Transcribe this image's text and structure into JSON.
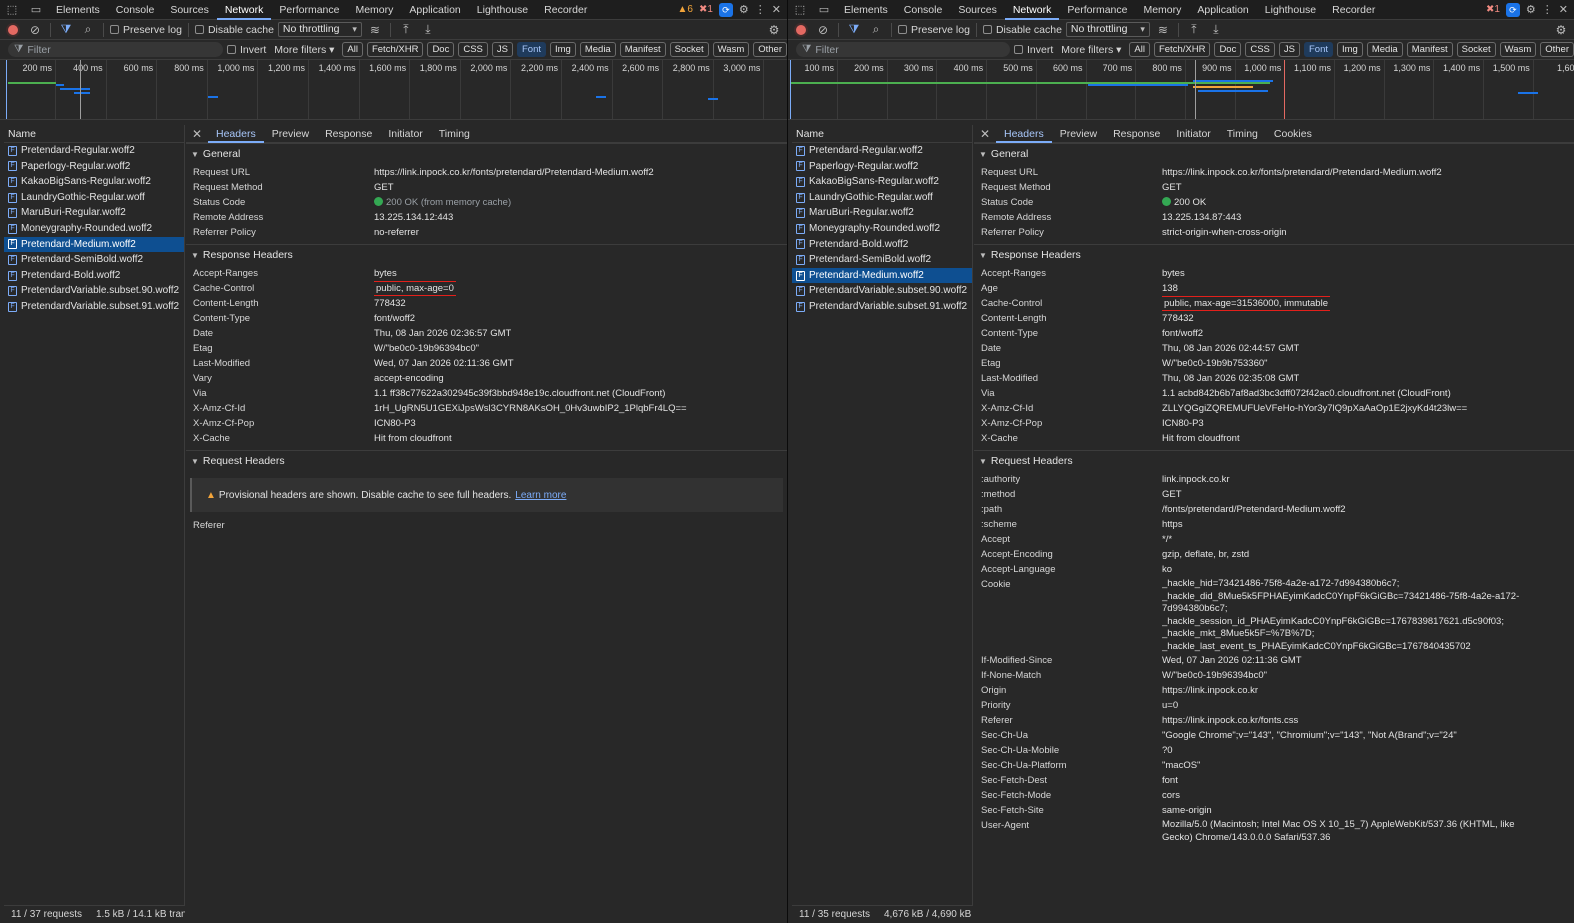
{
  "left": {
    "tabs": [
      "Elements",
      "Console",
      "Sources",
      "Network",
      "Performance",
      "Memory",
      "Application",
      "Lighthouse",
      "Recorder"
    ],
    "active_tab": "Network",
    "warnings": "6",
    "errors": "1",
    "toolbar": {
      "preserve_log": "Preserve log",
      "disable_cache": "Disable cache",
      "throttling": "No throttling"
    },
    "filter": {
      "placeholder": "Filter",
      "invert": "Invert",
      "more_filters": "More filters"
    },
    "filter_chips": [
      "All",
      "Fetch/XHR",
      "Doc",
      "CSS",
      "JS",
      "Font",
      "Img",
      "Media",
      "Manifest",
      "Socket",
      "Wasm",
      "Other"
    ],
    "active_chip": "Font",
    "timeline_ticks": [
      "200 ms",
      "400 ms",
      "600 ms",
      "800 ms",
      "1,000 ms",
      "1,200 ms",
      "1,400 ms",
      "1,600 ms",
      "1,800 ms",
      "2,000 ms",
      "2,200 ms",
      "2,400 ms",
      "2,600 ms",
      "2,800 ms",
      "3,000 ms"
    ],
    "name_header": "Name",
    "requests": [
      "Pretendard-Regular.woff2",
      "Paperlogy-Regular.woff2",
      "KakaoBigSans-Regular.woff2",
      "LaundryGothic-Regular.woff",
      "MaruBuri-Regular.woff2",
      "Moneygraphy-Rounded.woff2",
      "Pretendard-Medium.woff2",
      "Pretendard-SemiBold.woff2",
      "Pretendard-Bold.woff2",
      "PretendardVariable.subset.90.woff2",
      "PretendardVariable.subset.91.woff2"
    ],
    "selected_index": 6,
    "status": {
      "requests": "11 / 37 requests",
      "transfer": "1.5 kB / 14.1 kB transfe"
    },
    "detail_tabs": [
      "Headers",
      "Preview",
      "Response",
      "Initiator",
      "Timing"
    ],
    "general_title": "General",
    "general": [
      {
        "k": "Request URL",
        "v": "https://link.inpock.co.kr/fonts/pretendard/Pretendard-Medium.woff2"
      },
      {
        "k": "Request Method",
        "v": "GET"
      },
      {
        "k": "Status Code",
        "v": "200 OK (from memory cache)",
        "dot": true,
        "dim": true
      },
      {
        "k": "Remote Address",
        "v": "13.225.134.12:443"
      },
      {
        "k": "Referrer Policy",
        "v": "no-referrer"
      }
    ],
    "response_title": "Response Headers",
    "response": [
      {
        "k": "Accept-Ranges",
        "v": "bytes"
      },
      {
        "k": "Cache-Control",
        "v": "public, max-age=0",
        "highlight": true
      },
      {
        "k": "Content-Length",
        "v": "778432"
      },
      {
        "k": "Content-Type",
        "v": "font/woff2"
      },
      {
        "k": "Date",
        "v": "Thu, 08 Jan 2026 02:36:57 GMT"
      },
      {
        "k": "Etag",
        "v": "W/\"be0c0-19b96394bc0\""
      },
      {
        "k": "Last-Modified",
        "v": "Wed, 07 Jan 2026 02:11:36 GMT"
      },
      {
        "k": "Vary",
        "v": "accept-encoding"
      },
      {
        "k": "Via",
        "v": "1.1 ff38c77622a302945c39f3bbd948e19c.cloudfront.net (CloudFront)"
      },
      {
        "k": "X-Amz-Cf-Id",
        "v": "1rH_UgRN5U1GEXiJpsWsl3CYRN8AKsOH_0Hv3uwbIP2_1PlqbFr4LQ=="
      },
      {
        "k": "X-Amz-Cf-Pop",
        "v": "ICN80-P3"
      },
      {
        "k": "X-Cache",
        "v": "Hit from cloudfront"
      }
    ],
    "request_title": "Request Headers",
    "provisional_text": "Provisional headers are shown. Disable cache to see full headers.",
    "learn_more": "Learn more",
    "request": [
      {
        "k": "Referer",
        "v": ""
      }
    ]
  },
  "right": {
    "tabs": [
      "Elements",
      "Console",
      "Sources",
      "Network",
      "Performance",
      "Memory",
      "Application",
      "Lighthouse",
      "Recorder"
    ],
    "active_tab": "Network",
    "errors": "1",
    "toolbar": {
      "preserve_log": "Preserve log",
      "disable_cache": "Disable cache",
      "throttling": "No throttling"
    },
    "filter": {
      "placeholder": "Filter",
      "invert": "Invert",
      "more_filters": "More filters"
    },
    "filter_chips": [
      "All",
      "Fetch/XHR",
      "Doc",
      "CSS",
      "JS",
      "Font",
      "Img",
      "Media",
      "Manifest",
      "Socket",
      "Wasm",
      "Other"
    ],
    "active_chip": "Font",
    "timeline_ticks": [
      "100 ms",
      "200 ms",
      "300 ms",
      "400 ms",
      "500 ms",
      "600 ms",
      "700 ms",
      "800 ms",
      "900 ms",
      "1,000 ms",
      "1,100 ms",
      "1,200 ms",
      "1,300 ms",
      "1,400 ms",
      "1,500 ms",
      "1,600"
    ],
    "name_header": "Name",
    "requests": [
      "Pretendard-Regular.woff2",
      "Paperlogy-Regular.woff2",
      "KakaoBigSans-Regular.woff2",
      "LaundryGothic-Regular.woff",
      "MaruBuri-Regular.woff2",
      "Moneygraphy-Rounded.woff2",
      "Pretendard-Bold.woff2",
      "Pretendard-SemiBold.woff2",
      "Pretendard-Medium.woff2",
      "PretendardVariable.subset.90.woff2",
      "PretendardVariable.subset.91.woff2"
    ],
    "selected_index": 8,
    "status": {
      "requests": "11 / 35 requests",
      "transfer": "4,676 kB / 4,690 kB tr"
    },
    "detail_tabs": [
      "Headers",
      "Preview",
      "Response",
      "Initiator",
      "Timing",
      "Cookies"
    ],
    "general_title": "General",
    "general": [
      {
        "k": "Request URL",
        "v": "https://link.inpock.co.kr/fonts/pretendard/Pretendard-Medium.woff2"
      },
      {
        "k": "Request Method",
        "v": "GET"
      },
      {
        "k": "Status Code",
        "v": "200 OK",
        "dot": true
      },
      {
        "k": "Remote Address",
        "v": "13.225.134.87:443"
      },
      {
        "k": "Referrer Policy",
        "v": "strict-origin-when-cross-origin"
      }
    ],
    "response_title": "Response Headers",
    "response": [
      {
        "k": "Accept-Ranges",
        "v": "bytes"
      },
      {
        "k": "Age",
        "v": "138"
      },
      {
        "k": "Cache-Control",
        "v": "public, max-age=31536000, immutable",
        "highlight": true
      },
      {
        "k": "Content-Length",
        "v": "778432"
      },
      {
        "k": "Content-Type",
        "v": "font/woff2"
      },
      {
        "k": "Date",
        "v": "Thu, 08 Jan 2026 02:44:57 GMT"
      },
      {
        "k": "Etag",
        "v": "W/\"be0c0-19b9b753360\""
      },
      {
        "k": "Last-Modified",
        "v": "Thu, 08 Jan 2026 02:35:08 GMT"
      },
      {
        "k": "Via",
        "v": "1.1 acbd842b6b7af8ad3bc3dff072f42ac0.cloudfront.net (CloudFront)"
      },
      {
        "k": "X-Amz-Cf-Id",
        "v": "ZLLYQGgiZQREMUFUeVFeHo-hYor3y7lQ9pXaAaOp1E2jxyKd4t23lw=="
      },
      {
        "k": "X-Amz-Cf-Pop",
        "v": "ICN80-P3"
      },
      {
        "k": "X-Cache",
        "v": "Hit from cloudfront"
      }
    ],
    "request_title": "Request Headers",
    "request": [
      {
        "k": ":authority",
        "v": "link.inpock.co.kr"
      },
      {
        "k": ":method",
        "v": "GET"
      },
      {
        "k": ":path",
        "v": "/fonts/pretendard/Pretendard-Medium.woff2"
      },
      {
        "k": ":scheme",
        "v": "https"
      },
      {
        "k": "Accept",
        "v": "*/*"
      },
      {
        "k": "Accept-Encoding",
        "v": "gzip, deflate, br, zstd"
      },
      {
        "k": "Accept-Language",
        "v": "ko"
      },
      {
        "k": "Cookie",
        "v": "_hackle_hid=73421486-75f8-4a2e-a172-7d994380b6c7; _hackle_did_8Mue5k5FPHAEyimKadcC0YnpF6kGiGBc=73421486-75f8-4a2e-a172-7d994380b6c7; _hackle_session_id_PHAEyimKadcC0YnpF6kGiGBc=1767839817621.d5c90f03; _hackle_mkt_8Mue5k5F=%7B%7D; _hackle_last_event_ts_PHAEyimKadcC0YnpF6kGiGBc=1767840435702",
        "wrap": true
      },
      {
        "k": "If-Modified-Since",
        "v": "Wed, 07 Jan 2026 02:11:36 GMT"
      },
      {
        "k": "If-None-Match",
        "v": "W/\"be0c0-19b96394bc0\""
      },
      {
        "k": "Origin",
        "v": "https://link.inpock.co.kr"
      },
      {
        "k": "Priority",
        "v": "u=0"
      },
      {
        "k": "Referer",
        "v": "https://link.inpock.co.kr/fonts.css"
      },
      {
        "k": "Sec-Ch-Ua",
        "v": "\"Google Chrome\";v=\"143\", \"Chromium\";v=\"143\", \"Not A(Brand\";v=\"24\""
      },
      {
        "k": "Sec-Ch-Ua-Mobile",
        "v": "?0"
      },
      {
        "k": "Sec-Ch-Ua-Platform",
        "v": "\"macOS\""
      },
      {
        "k": "Sec-Fetch-Dest",
        "v": "font"
      },
      {
        "k": "Sec-Fetch-Mode",
        "v": "cors"
      },
      {
        "k": "Sec-Fetch-Site",
        "v": "same-origin"
      },
      {
        "k": "User-Agent",
        "v": "Mozilla/5.0 (Macintosh; Intel Mac OS X 10_15_7) AppleWebKit/537.36 (KHTML, like Gecko) Chrome/143.0.0.0 Safari/537.36",
        "wrap": true
      }
    ]
  },
  "colors": {
    "accent": "#7cacf8",
    "selected_row": "#0e4f91",
    "highlight_box": "#e3201b",
    "status_ok": "#34a853"
  }
}
